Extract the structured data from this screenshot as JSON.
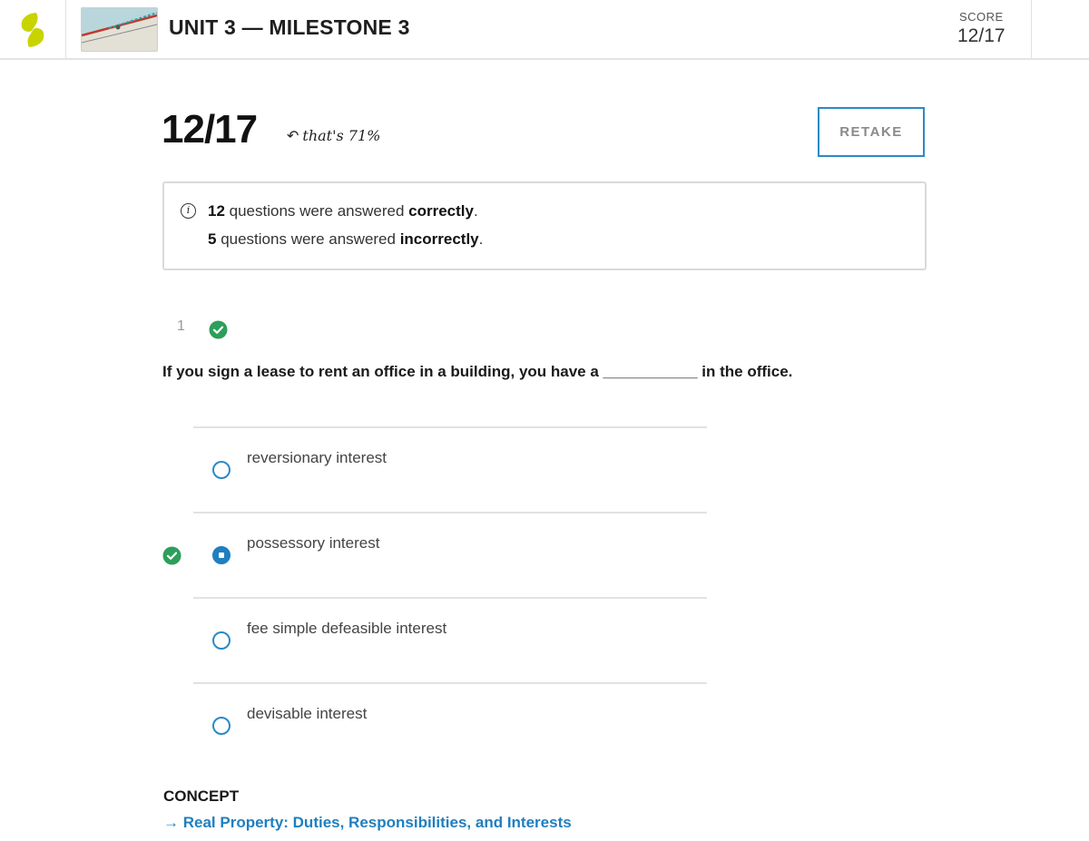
{
  "header": {
    "title": "UNIT 3 — MILESTONE 3",
    "score_label": "SCORE",
    "score_value": "12/17"
  },
  "summary": {
    "score": "12/17",
    "percent_note": "that's 71%",
    "retake_label": "RETAKE",
    "correct_count": "12",
    "incorrect_count": "5",
    "line1_text": " questions were answered ",
    "line1_bold": "correctly",
    "line2_text": " questions were answered ",
    "line2_bold": "incorrectly",
    "period": "."
  },
  "question": {
    "number": "1",
    "status": "correct",
    "text": "If you sign a lease to rent an office in a building, you have a ___________ in the office.",
    "options": [
      {
        "label": "reversionary interest",
        "selected": false,
        "correct": false
      },
      {
        "label": "possessory interest",
        "selected": true,
        "correct": true
      },
      {
        "label": "fee simple defeasible interest",
        "selected": false,
        "correct": false
      },
      {
        "label": "devisable interest",
        "selected": false,
        "correct": false
      }
    ]
  },
  "concept": {
    "label": "CONCEPT",
    "link_arrow": "→",
    "link_text": "Real Property: Duties, Responsibilities, and Interests"
  },
  "colors": {
    "accent": "#1f7fbf",
    "success": "#2e9e5b",
    "logo": "#c8d400"
  },
  "icons": [
    "logo-icon",
    "info-icon",
    "check-circle-icon",
    "radio-icon",
    "arrow-right-icon"
  ]
}
